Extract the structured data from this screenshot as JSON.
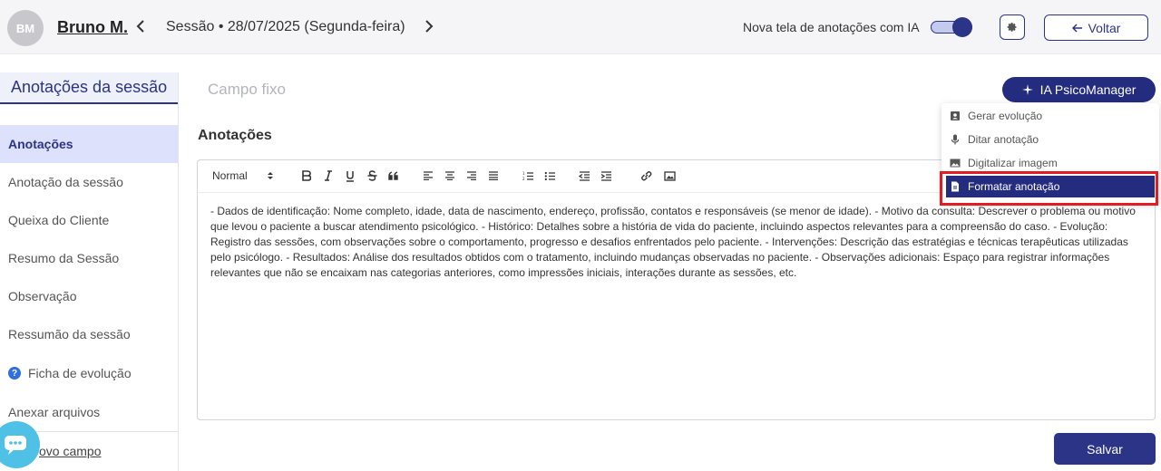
{
  "header": {
    "avatar_initials": "BM",
    "patient_name": "Bruno M.",
    "session_label": "Sessão • 28/07/2025 (Segunda-feira)",
    "ai_toggle_label": "Nova tela de anotações com IA",
    "ai_toggle_on": true,
    "back_label": "Voltar"
  },
  "sidebar": {
    "title": "Anotações da sessão",
    "items": [
      {
        "label": "Anotações",
        "active": true
      },
      {
        "label": "Anotação da sessão"
      },
      {
        "label": "Queixa do Cliente"
      },
      {
        "label": "Resumo da Sessão"
      },
      {
        "label": "Observação"
      },
      {
        "label": "Ressumão da sessão"
      },
      {
        "label": "Ficha de evolução",
        "icon": "help-circle-icon"
      },
      {
        "label": "Anexar arquivos"
      }
    ],
    "new_field_label": "ovo campo"
  },
  "main": {
    "campo_fixo": "Campo fixo",
    "ia_button": "IA PsicoManager",
    "notes_label": "Anotações",
    "editor": {
      "format_select": "Normal",
      "content": "- Dados de identificação: Nome completo, idade, data de nascimento, endereço, profissão, contatos e responsáveis (se menor de idade). - Motivo da consulta: Descrever o problema ou motivo que levou o paciente a buscar atendimento psicológico. - Histórico: Detalhes sobre a história de vida do paciente, incluindo aspectos relevantes para a compreensão do caso. - Evolução: Registro das sessões, com observações sobre o comportamento, progresso e desafios enfrentados pelo paciente. - Intervenções: Descrição das estratégias e técnicas terapêuticas utilizadas pelo psicólogo. - Resultados: Análise dos resultados obtidos com o tratamento, incluindo mudanças observadas no paciente. - Observações adicionais: Espaço para registrar informações relevantes que não se encaixam nas categorias anteriores, como impressões iniciais, interações durante as sessões, etc."
    },
    "save_label": "Salvar"
  },
  "ia_menu": {
    "items": [
      {
        "label": "Gerar evolução",
        "icon": "contact-card-icon"
      },
      {
        "label": "Ditar anotação",
        "icon": "microphone-icon"
      },
      {
        "label": "Digitalizar imagem",
        "icon": "image-icon"
      },
      {
        "label": "Formatar anotação",
        "icon": "document-icon",
        "highlighted": true
      }
    ]
  },
  "colors": {
    "primary": "#2c3487",
    "highlight_frame": "#e21b24",
    "chat_fab": "#4fc0e6"
  }
}
